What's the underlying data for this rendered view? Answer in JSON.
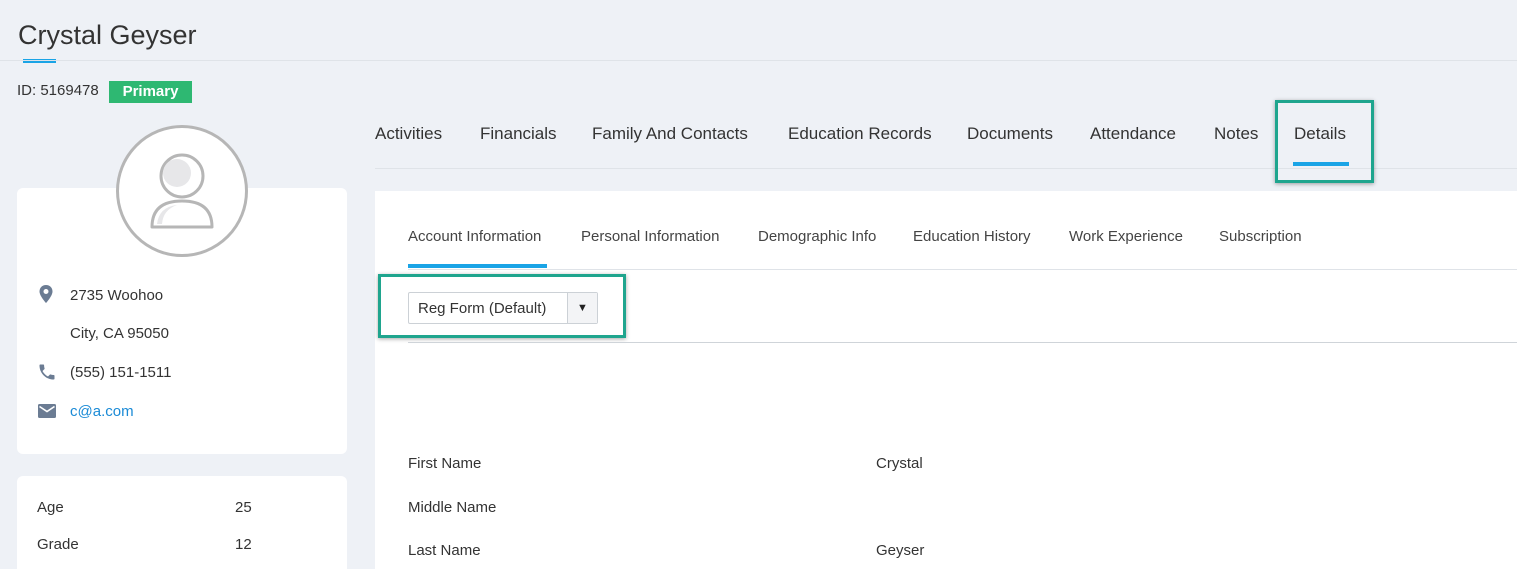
{
  "person": {
    "name": "Crystal Geyser",
    "id_text": "ID: 5169478",
    "badge": "Primary"
  },
  "contact": {
    "address_line1": "2735 Woohoo",
    "address_line2": "City, CA 95050",
    "phone": "(555) 151-1511",
    "email": "c@a.com"
  },
  "stats": [
    {
      "label": "Age",
      "value": "25"
    },
    {
      "label": "Grade",
      "value": "12"
    }
  ],
  "main_tabs": [
    {
      "label": "Activities"
    },
    {
      "label": "Financials"
    },
    {
      "label": "Family And Contacts"
    },
    {
      "label": "Education Records"
    },
    {
      "label": "Documents"
    },
    {
      "label": "Attendance"
    },
    {
      "label": "Notes"
    },
    {
      "label": "Details",
      "active": true
    }
  ],
  "sub_tabs": [
    {
      "label": "Account Information",
      "active": true
    },
    {
      "label": "Personal Information"
    },
    {
      "label": "Demographic Info"
    },
    {
      "label": "Education History"
    },
    {
      "label": "Work Experience"
    },
    {
      "label": "Subscription"
    }
  ],
  "form_select": {
    "value": "Reg Form (Default)",
    "arrow": "▼"
  },
  "fields": [
    {
      "label": "First Name",
      "value": "Crystal"
    },
    {
      "label": "Middle Name",
      "value": ""
    },
    {
      "label": "Last Name",
      "value": "Geyser"
    }
  ],
  "colors": {
    "accent": "#1aa4e6",
    "badge_green": "#2eb872",
    "highlight_teal": "#1fa58e",
    "icon_gray": "#6b7c93",
    "link_blue": "#1a8ad6"
  },
  "icons": {
    "location": "map-pin-icon",
    "phone": "phone-icon",
    "email": "envelope-icon",
    "avatar": "user-icon"
  }
}
